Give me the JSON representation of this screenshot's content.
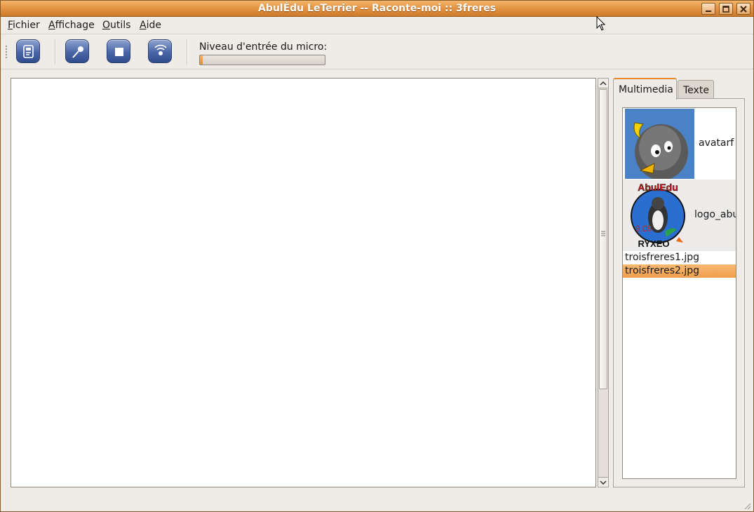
{
  "window": {
    "title": "AbulÉdu LeTerrier -- Raconte-moi :: 3freres"
  },
  "menu": {
    "items": [
      "Fichier",
      "Affichage",
      "Outils",
      "Aide"
    ]
  },
  "toolbar": {
    "buttons": [
      "open-document-icon",
      "record-microphone-icon",
      "stop-icon",
      "play-sound-icon"
    ],
    "mic_label": "Niveau d'entrée du micro:",
    "mic_level": 0.01
  },
  "tabs": {
    "items": [
      "Multimedia",
      "Texte"
    ],
    "active": "Multimedia"
  },
  "media": {
    "items": [
      {
        "label": "avatarf",
        "thumbnail": "penguin-avatar-icon"
      },
      {
        "label": "logo_abu",
        "thumbnail": "abuledu-logo-icon",
        "logo_text_top": "AbulEdu",
        "logo_text_bottom": "RYXEO",
        "logo_version": "9.08"
      },
      {
        "label": "troisfreres1.jpg"
      },
      {
        "label": "troisfreres2.jpg",
        "selected": true
      }
    ]
  },
  "colors": {
    "titlebar": "#e59645",
    "accent": "#ef9e4e",
    "toolbar_button": "#4a66a8"
  }
}
